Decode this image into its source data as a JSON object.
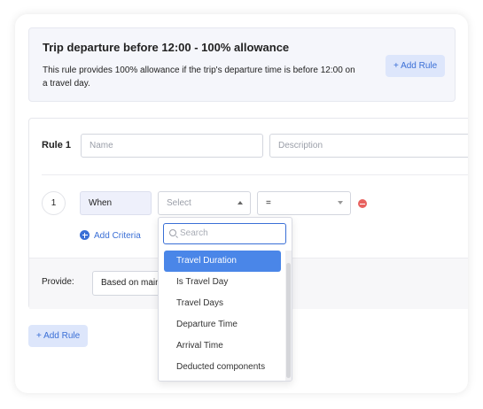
{
  "intro": {
    "title": "Trip departure before 12:00 - 100% allowance",
    "description": "This rule provides 100% allowance if the trip's departure time is before 12:00 on a travel day.",
    "add_rule_label": "+ Add Rule"
  },
  "rule": {
    "label": "Rule 1",
    "name_placeholder": "Name",
    "description_placeholder": "Description",
    "condition": {
      "index": "1",
      "when_label": "When",
      "field_placeholder": "Select",
      "operator_value": "="
    },
    "add_criteria_label": "Add Criteria",
    "provide_label": "Provide:",
    "provide_value": "Based on main"
  },
  "dropdown": {
    "search_placeholder": "Search",
    "options": [
      "Travel Duration",
      "Is Travel Day",
      "Travel Days",
      "Departure Time",
      "Arrival Time",
      "Deducted components"
    ],
    "selected": "Travel Duration"
  },
  "footer": {
    "add_rule_label": "+ Add Rule"
  },
  "colors": {
    "accent": "#3a6fd6",
    "selected_bg": "#4a86e8",
    "remove": "#e8625f"
  }
}
